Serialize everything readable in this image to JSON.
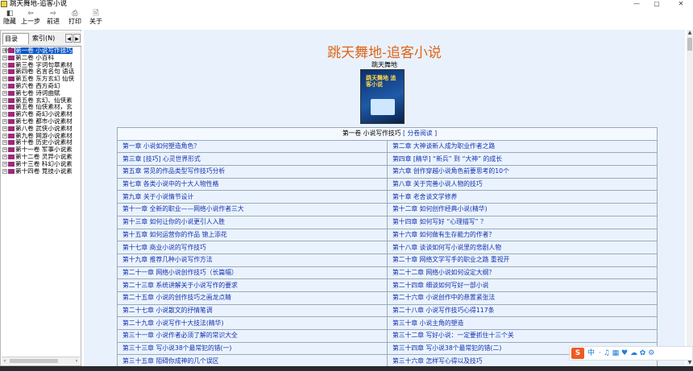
{
  "window": {
    "title": "跳天舞地-追客小说",
    "minimize": "—",
    "maximize": "▢",
    "close": "✕"
  },
  "toolbar": {
    "hide": "隐藏",
    "back": "上一步",
    "forward": "前进",
    "print": "打印",
    "about": "关于"
  },
  "left_panel": {
    "tabs": [
      "目录(C)",
      "索引(N)"
    ],
    "tree": [
      {
        "label": "第一卷 小说写作技巧",
        "selected": true
      },
      {
        "label": "第二卷 小百科"
      },
      {
        "label": "第三卷 字词句章素材"
      },
      {
        "label": "第四卷 名言名句 语话"
      },
      {
        "label": "第五卷 东方玄幻 仙侠"
      },
      {
        "label": "第六卷 西方奇幻"
      },
      {
        "label": "第七卷 诗词曲赋"
      },
      {
        "label": "第五卷 玄幻、仙侠素"
      },
      {
        "label": "第五卷 仙侠素材，玄"
      },
      {
        "label": "第六卷 奇幻小说素材"
      },
      {
        "label": "第七卷 都市小说素材"
      },
      {
        "label": "第八卷 武侠小说素材"
      },
      {
        "label": "第九卷 网游小说素材"
      },
      {
        "label": "第十卷 历史小说素材"
      },
      {
        "label": "第十一卷 军事小说素"
      },
      {
        "label": "第十二卷 灵异小说素"
      },
      {
        "label": "第十三卷 科幻小说素"
      },
      {
        "label": "第十四卷 竞技小说素"
      }
    ]
  },
  "main": {
    "book_title": "跳天舞地-追客小说",
    "author": "跳天舞地",
    "cover_text": "跳天舞地 追客小说",
    "volume_header": "第一卷 小说写作技巧",
    "volume_link": "[ 分卷阅读 ]",
    "chapters": [
      [
        "第一章 小说如何塑造角色？",
        "第二章 大神谈新人成为职业作者之路"
      ],
      [
        "第三章 [技巧] 心灵世界形式",
        "第四章 [精华] “新兵” 到 “大神” 的成长"
      ],
      [
        "第五章 常见的作品类型写作技巧分析",
        "第六章 创作穿越小说角色前要思考的10个"
      ],
      [
        "第七章 各类小说中的十大人物性格",
        "第八章 关于完善小说人物的技巧"
      ],
      [
        "第九章 关于小说情节设计",
        "第十章 老舍谈文学修养"
      ],
      [
        "第十一章 全新的职业——网络小说作者三大",
        "第十二章 如何创作经典小说(精华)"
      ],
      [
        "第十三章 如何让你的小说更引人入胜",
        "第十四章 如何写好 “心理描写” ？"
      ],
      [
        "第十五章 如何运营你的作品 锦上添花",
        "第十六章 如何做有生存能力的作者？"
      ],
      [
        "第十七章 商业小说的写作技巧",
        "第十八章 谈谈如何写小说里的悲剧人物"
      ],
      [
        "第十九章 推荐几种小说写作方法",
        "第二十章 网络文学写手的职业之路 重视开"
      ],
      [
        "第二十一章 网络小说创作技巧（长篇幅）",
        "第二十二章 网络小说如何设定大纲？"
      ],
      [
        "第二十三章 系统讲解关于小说写作的要求",
        "第二十四章 细谈如何写好一部小说"
      ],
      [
        "第二十五章 小说的创作技巧之画龙点睛",
        "第二十六章 小说创作中的悬置紧张法"
      ],
      [
        "第二十七章 小说散文的抒情笔调",
        "第二十八章 小说写作技巧心得117条"
      ],
      [
        "第二十九章 小说写作十大技法(精华)",
        "第三十章 小说主角的塑造"
      ],
      [
        "第三十一章 小说作者必须了解的常识大全",
        "第三十二章 写好小说：一定要抓住十三个关"
      ],
      [
        "第三十三章 写小说38个最常犯的错(一)",
        "第三十四章 写小说38个最常犯的错(二)"
      ],
      [
        "第三十五章 阻碍你成神的几个误区",
        "第三十六章 怎样写心得以及技巧"
      ]
    ]
  },
  "tray": {
    "ime": "S",
    "lang": "中",
    "icons": "·  ♫  ▦  ♥  ☁  ✿  ⚙"
  }
}
